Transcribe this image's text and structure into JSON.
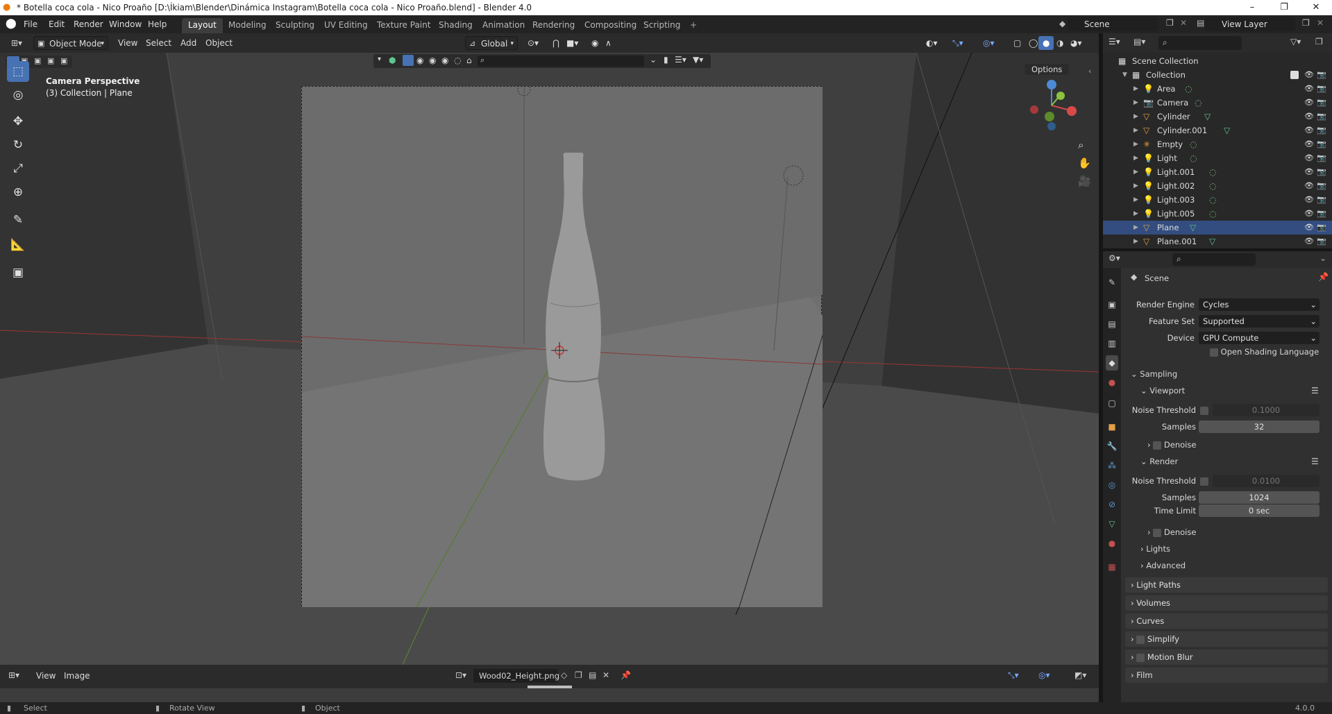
{
  "titlebar": {
    "title": "* Botella coca cola - Nico Proaño [D:\\Íkiam\\Blender\\Dinámica Instagram\\Botella coca cola - Nico Proaño.blend] - Blender 4.0",
    "minimize": "–",
    "maximize": "❐",
    "close": "✕"
  },
  "menubar": {
    "items": [
      "File",
      "Edit",
      "Render",
      "Window",
      "Help"
    ]
  },
  "workspaces": {
    "tabs": [
      "Layout",
      "Modeling",
      "Sculpting",
      "UV Editing",
      "Texture Paint",
      "Shading",
      "Animation",
      "Rendering",
      "Compositing",
      "Scripting"
    ],
    "active": "Layout",
    "add": "+"
  },
  "scene_selector": {
    "value": "Scene"
  },
  "viewlayer_selector": {
    "value": "View Layer"
  },
  "viewport_header": {
    "mode": "Object Mode",
    "menus": [
      "View",
      "Select",
      "Add",
      "Object"
    ],
    "transform_orientation": "Global",
    "options": "Options"
  },
  "viewport": {
    "overlay_title": "Camera Perspective",
    "overlay_subtitle": "(3) Collection | Plane"
  },
  "outliner": {
    "root": "Scene Collection",
    "collection": "Collection",
    "items": [
      {
        "name": "Area",
        "icon": "light-icon"
      },
      {
        "name": "Camera",
        "icon": "camera-icon"
      },
      {
        "name": "Cylinder",
        "icon": "mesh-icon"
      },
      {
        "name": "Cylinder.001",
        "icon": "mesh-icon"
      },
      {
        "name": "Empty",
        "icon": "empty-icon"
      },
      {
        "name": "Light",
        "icon": "light-icon"
      },
      {
        "name": "Light.001",
        "icon": "light-icon"
      },
      {
        "name": "Light.002",
        "icon": "light-icon"
      },
      {
        "name": "Light.003",
        "icon": "light-icon"
      },
      {
        "name": "Light.005",
        "icon": "light-icon"
      },
      {
        "name": "Plane",
        "icon": "mesh-icon"
      },
      {
        "name": "Plane.001",
        "icon": "mesh-icon"
      }
    ]
  },
  "properties": {
    "context": "Scene",
    "render_engine_label": "Render Engine",
    "render_engine": "Cycles",
    "feature_set_label": "Feature Set",
    "feature_set": "Supported",
    "device_label": "Device",
    "device": "GPU Compute",
    "osl_label": "Open Shading Language",
    "sampling": "Sampling",
    "viewport": "Viewport",
    "noise_threshold_label": "Noise Threshold",
    "viewport_noise_threshold": "0.1000",
    "samples_label": "Samples",
    "viewport_samples": "32",
    "denoise": "Denoise",
    "render": "Render",
    "render_noise_threshold": "0.0100",
    "render_samples": "1024",
    "time_limit_label": "Time Limit",
    "time_limit": "0 sec",
    "lights": "Lights",
    "advanced": "Advanced",
    "panels": [
      "Light Paths",
      "Volumes",
      "Curves",
      "Simplify",
      "Motion Blur",
      "Film"
    ]
  },
  "image_editor": {
    "menus": [
      "View",
      "Image"
    ],
    "image_name": "Wood02_Height.png"
  },
  "statusbar": {
    "select": "Select",
    "rotate": "Rotate View",
    "object": "Object",
    "version": "4.0.0"
  },
  "colors": {
    "accent": "#4772b3",
    "mesh": "#5fc58f",
    "object_orange": "#e3a045",
    "light_icon": "#7ec883"
  }
}
